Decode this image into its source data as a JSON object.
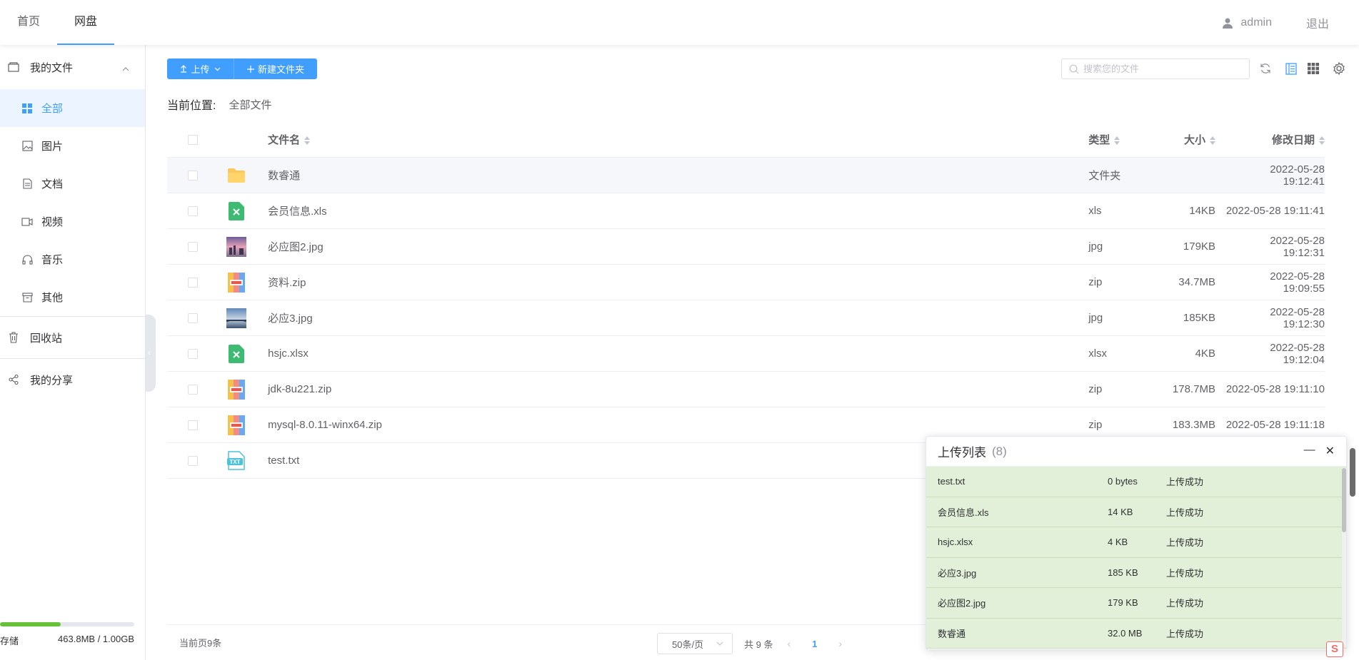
{
  "header": {
    "nav": [
      {
        "label": "首页"
      },
      {
        "label": "网盘"
      }
    ],
    "user": "admin",
    "logout": "退出"
  },
  "sidebar": {
    "my_files": "我的文件",
    "items": [
      {
        "label": "全部",
        "icon": "grid-icon"
      },
      {
        "label": "图片",
        "icon": "image-icon"
      },
      {
        "label": "文档",
        "icon": "document-icon"
      },
      {
        "label": "视频",
        "icon": "video-icon"
      },
      {
        "label": "音乐",
        "icon": "headphones-icon"
      },
      {
        "label": "其他",
        "icon": "box-icon"
      }
    ],
    "recycle": "回收站",
    "share": "我的分享",
    "storage": {
      "label": "存储",
      "used_text": "463.8MB / 1.00GB",
      "used_fraction": 0.45
    }
  },
  "toolbar": {
    "upload": "上传",
    "new_folder": "新建文件夹",
    "search_placeholder": "搜索您的文件"
  },
  "breadcrumb": {
    "label": "当前位置:",
    "value": "全部文件"
  },
  "table": {
    "columns": {
      "name": "文件名",
      "type": "类型",
      "size": "大小",
      "date": "修改日期"
    },
    "rows": [
      {
        "name": "数睿通",
        "type": "文件夹",
        "size": "",
        "date": "2022-05-28 19:12:41",
        "icon": "folder-icon"
      },
      {
        "name": "会员信息.xls",
        "type": "xls",
        "size": "14KB",
        "date": "2022-05-28 19:11:41",
        "icon": "excel-icon"
      },
      {
        "name": "必应图2.jpg",
        "type": "jpg",
        "size": "179KB",
        "date": "2022-05-28 19:12:31",
        "icon": "image-thumb-sunset"
      },
      {
        "name": "资料.zip",
        "type": "zip",
        "size": "34.7MB",
        "date": "2022-05-28 19:09:55",
        "icon": "zip-icon"
      },
      {
        "name": "必应3.jpg",
        "type": "jpg",
        "size": "185KB",
        "date": "2022-05-28 19:12:30",
        "icon": "image-thumb-bridge"
      },
      {
        "name": "hsjc.xlsx",
        "type": "xlsx",
        "size": "4KB",
        "date": "2022-05-28 19:12:04",
        "icon": "excel-icon"
      },
      {
        "name": "jdk-8u221.zip",
        "type": "zip",
        "size": "178.7MB",
        "date": "2022-05-28 19:11:10",
        "icon": "zip-icon"
      },
      {
        "name": "mysql-8.0.11-winx64.zip",
        "type": "zip",
        "size": "183.3MB",
        "date": "2022-05-28 19:11:18",
        "icon": "zip-icon"
      },
      {
        "name": "test.txt",
        "type": "",
        "size": "",
        "date": "",
        "icon": "txt-icon"
      }
    ]
  },
  "footer": {
    "current": "当前页9条",
    "page_size": "50条/页",
    "total": "共 9 条",
    "page": "1"
  },
  "upload_panel": {
    "title": "上传列表",
    "count": "(8)",
    "rows": [
      {
        "name": "test.txt",
        "size": "0 bytes",
        "status": "上传成功"
      },
      {
        "name": "会员信息.xls",
        "size": "14 KB",
        "status": "上传成功"
      },
      {
        "name": "hsjc.xlsx",
        "size": "4 KB",
        "status": "上传成功"
      },
      {
        "name": "必应3.jpg",
        "size": "185 KB",
        "status": "上传成功"
      },
      {
        "name": "必应图2.jpg",
        "size": "179 KB",
        "status": "上传成功"
      },
      {
        "name": "数睿通",
        "size": "32.0 MB",
        "status": "上传成功"
      }
    ]
  },
  "colors": {
    "primary": "#409eff",
    "success_bg": "#e2f0d9",
    "storage_fill": "#67c23a"
  }
}
